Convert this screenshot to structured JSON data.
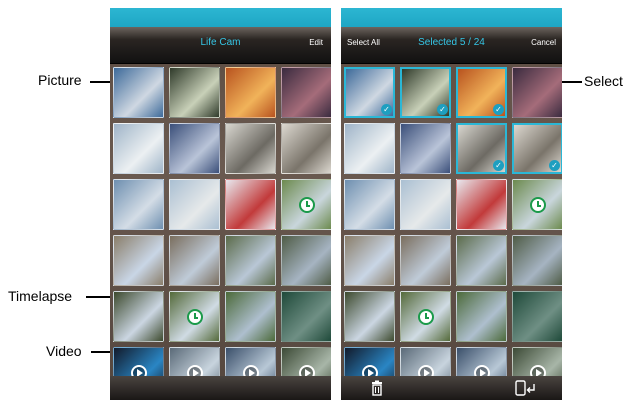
{
  "left_screen": {
    "title": "Life Cam",
    "edit_label": "Edit"
  },
  "right_screen": {
    "select_all_label": "Select All",
    "title": "Selected 5 / 24",
    "cancel_label": "Cancel",
    "bottom_icons": [
      "trash-icon",
      "share-to-phone-icon"
    ]
  },
  "annotations": {
    "picture": "Picture",
    "timelapse": "Timelapse",
    "video": "Video",
    "select": "Select"
  },
  "colors": {
    "accent": "#2bb7d6",
    "status_bar": "#1ea6c4",
    "timelapse_badge": "#1b9a4a"
  },
  "thumbnails": [
    {
      "type": "picture",
      "colors": [
        "#3d6a9a",
        "#cfd8e2"
      ]
    },
    {
      "type": "picture",
      "colors": [
        "#2f3a2a",
        "#c8d0b8"
      ]
    },
    {
      "type": "picture",
      "colors": [
        "#b8531f",
        "#f1b35a"
      ]
    },
    {
      "type": "picture",
      "colors": [
        "#3a2b3f",
        "#a56c7a"
      ]
    },
    {
      "type": "picture",
      "colors": [
        "#9fb4c8",
        "#ecf0f2"
      ]
    },
    {
      "type": "picture",
      "colors": [
        "#3b4f7a",
        "#b9c4d8"
      ]
    },
    {
      "type": "picture",
      "colors": [
        "#d8d6cf",
        "#6d6a63"
      ]
    },
    {
      "type": "picture",
      "colors": [
        "#dcd8d0",
        "#7a746a"
      ]
    },
    {
      "type": "picture",
      "colors": [
        "#6e8fb0",
        "#d4dde6"
      ]
    },
    {
      "type": "picture",
      "colors": [
        "#aabfd2",
        "#e6e9ea"
      ]
    },
    {
      "type": "picture",
      "colors": [
        "#e8e8ee",
        "#c23a3a"
      ]
    },
    {
      "type": "timelapse",
      "colors": [
        "#6c8a4e",
        "#c9d6dc"
      ]
    },
    {
      "type": "picture",
      "colors": [
        "#8a7e6a",
        "#c9d6e6"
      ]
    },
    {
      "type": "picture",
      "colors": [
        "#7a6e5e",
        "#bfcbd8"
      ]
    },
    {
      "type": "picture",
      "colors": [
        "#5b6b4a",
        "#b9c7d6"
      ]
    },
    {
      "type": "picture",
      "colors": [
        "#4f5c46",
        "#a6b4c2"
      ]
    },
    {
      "type": "picture",
      "colors": [
        "#3d4a2e",
        "#cbd6e2"
      ]
    },
    {
      "type": "timelapse",
      "colors": [
        "#546a3a",
        "#d0dbe4"
      ]
    },
    {
      "type": "picture",
      "colors": [
        "#4c6a3a",
        "#aebfce"
      ]
    },
    {
      "type": "picture",
      "colors": [
        "#1f4a3a",
        "#6f8f84"
      ]
    },
    {
      "type": "video",
      "colors": [
        "#121a2a",
        "#2a86c4"
      ]
    },
    {
      "type": "video",
      "colors": [
        "#5a6a78",
        "#c8d4de"
      ]
    },
    {
      "type": "video",
      "colors": [
        "#3a4f6a",
        "#b8c8d6"
      ]
    },
    {
      "type": "video",
      "colors": [
        "#3c4a36",
        "#a8b6a8"
      ]
    }
  ],
  "selected_indices": [
    0,
    1,
    2,
    6,
    7
  ]
}
